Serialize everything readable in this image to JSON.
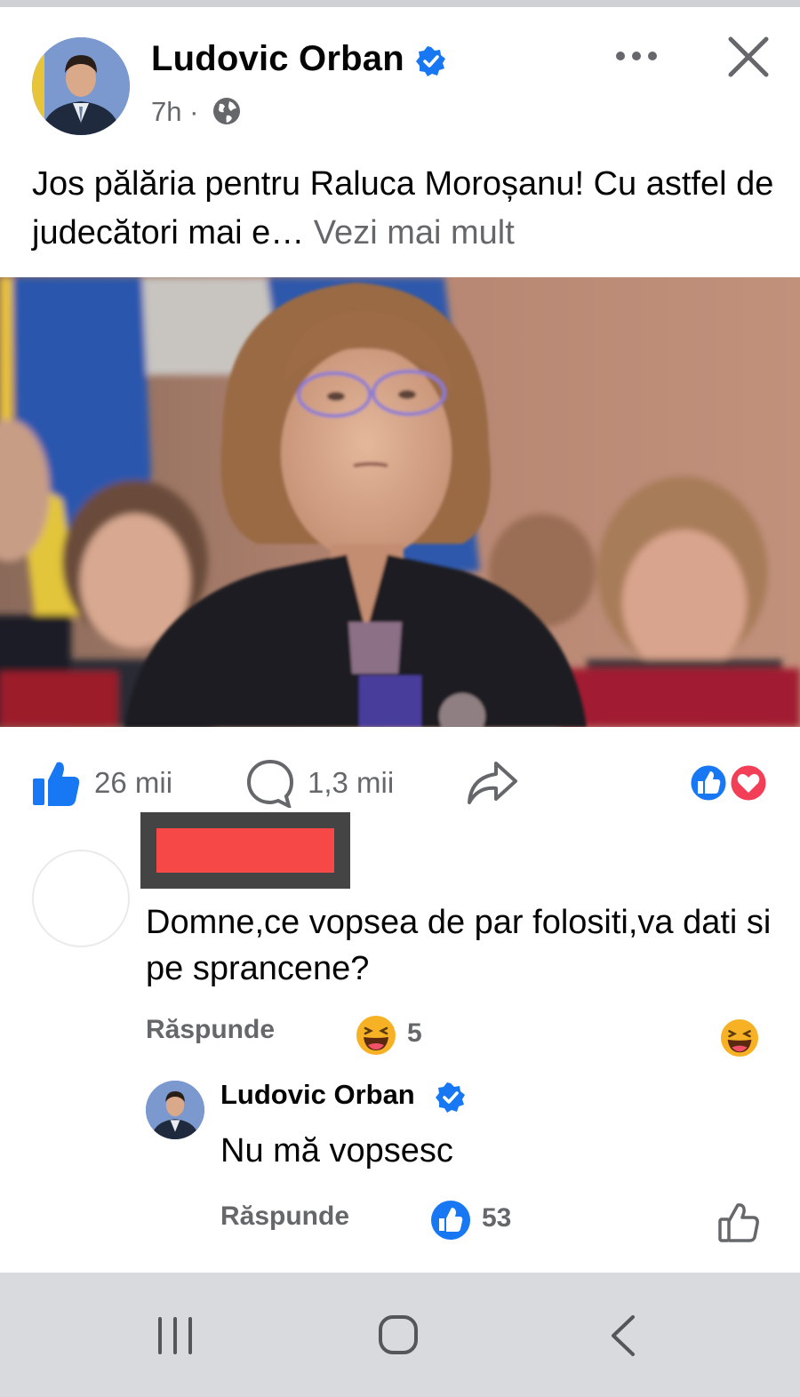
{
  "post": {
    "author": "Ludovic Orban",
    "time": "7h",
    "separator": "·",
    "text": "Jos pălăria pentru Raluca Moroșanu! Cu astfel de judecători mai e…",
    "see_more": " Vezi mai mult"
  },
  "actions": {
    "likes": "26 mii",
    "comments": "1,3 mii"
  },
  "comment": {
    "text": "Domne,ce vopsea de par folositi,va dati si pe sprancene?",
    "reply_label": "Răspunde",
    "reaction_count": "5"
  },
  "reply": {
    "author": "Ludovic Orban",
    "text": "Nu mă vopsesc",
    "reply_label": "Răspunde",
    "reaction_count": "53"
  },
  "colors": {
    "facebook_blue": "#1877f2",
    "secondary_text": "#65676b",
    "love_red": "#f33e58",
    "haha_yellow": "#f7b125",
    "redaction_red": "#f74848"
  },
  "icons": [
    "verified-badge-icon",
    "globe-icon",
    "more-icon",
    "close-icon",
    "like-icon",
    "comment-icon",
    "share-icon",
    "love-icon",
    "haha-icon",
    "nav-recent-icon",
    "nav-home-icon",
    "nav-back-icon"
  ]
}
